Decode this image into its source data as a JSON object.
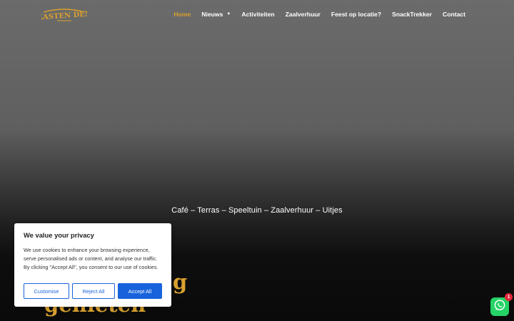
{
  "header": {
    "logo_text": "KASTEN DEN",
    "nav": [
      {
        "label": "Home",
        "active": true
      },
      {
        "label": "Nieuws",
        "has_dropdown": true
      },
      {
        "label": "Activiteiten"
      },
      {
        "label": "Zaalverhuur"
      },
      {
        "label": "Feest op locatie?"
      },
      {
        "label": "SnackTrekker"
      },
      {
        "label": "Contact"
      }
    ]
  },
  "hero": {
    "tagline": "Café – Terras – Speeltuin – Zaalverhuur – Uitjes",
    "heading_line_1": "g",
    "heading_line_2": "genieten"
  },
  "cookie_banner": {
    "title": "We value your privacy",
    "text": "We use cookies to enhance your browsing experience, serve personalised ads or content, and analyse our traffic. By clicking \"Accept All\", you consent to our use of cookies.",
    "customise_label": "Customise",
    "reject_label": "Reject All",
    "accept_label": "Accept All"
  },
  "whatsapp": {
    "icon": "whatsapp-icon",
    "badge_count": "1"
  },
  "colors": {
    "accent": "#d9a12e",
    "cookie_button": "#1863dc",
    "whatsapp": "#25d366",
    "badge": "#e0283a"
  }
}
